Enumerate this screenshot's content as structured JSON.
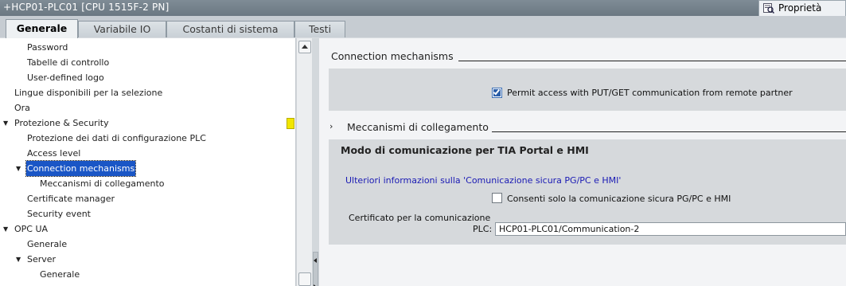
{
  "window": {
    "title": "+HCP01-PLC01 [CPU 1515F-2 PN]",
    "properties_tab": "Proprietà"
  },
  "tabs": [
    "Generale",
    "Variabile IO",
    "Costanti di sistema",
    "Testi"
  ],
  "active_tab": "Generale",
  "tree": [
    {
      "label": "Password",
      "level": 2,
      "caret": ""
    },
    {
      "label": "Tabelle di controllo",
      "level": 2,
      "caret": ""
    },
    {
      "label": "User-defined logo",
      "level": 2,
      "caret": ""
    },
    {
      "label": "Lingue disponibili per la selezione",
      "level": 1,
      "caret": ""
    },
    {
      "label": "Ora",
      "level": 1,
      "caret": ""
    },
    {
      "label": "Protezione & Security",
      "level": 1,
      "caret": "expanded"
    },
    {
      "label": "Protezione dei dati di configurazione PLC",
      "level": 2,
      "caret": ""
    },
    {
      "label": "Access level",
      "level": 2,
      "caret": ""
    },
    {
      "label": "Connection mechanisms",
      "level": 2,
      "caret": "expanded",
      "selected": true
    },
    {
      "label": "Meccanismi di collegamento",
      "level": 3,
      "caret": ""
    },
    {
      "label": "Certificate manager",
      "level": 2,
      "caret": ""
    },
    {
      "label": "Security event",
      "level": 2,
      "caret": ""
    },
    {
      "label": "OPC UA",
      "level": 1,
      "caret": "expanded"
    },
    {
      "label": "Generale",
      "level": 2,
      "caret": ""
    },
    {
      "label": "Server",
      "level": 2,
      "caret": "expanded"
    },
    {
      "label": "Generale",
      "level": 3,
      "caret": ""
    }
  ],
  "content": {
    "section1": {
      "title": "Connection mechanisms",
      "checkbox_label": "Permit access with PUT/GET communication from remote partner",
      "checked": true
    },
    "section2": {
      "title": "Meccanismi di collegamento",
      "subtitle": "Modo di comunicazione per TIA Portal e HMI",
      "link": "Ulteriori informazioni sulla 'Comunicazione sicura PG/PC e HMI'",
      "checkbox_label": "Consenti solo la comunicazione sicura PG/PC e HMI",
      "checked": false,
      "cert_label_line1": "Certificato per la comunicazione",
      "cert_label_line2": "PLC:",
      "cert_value": "HCP01-PLC01/Communication-2"
    }
  },
  "colors": {
    "selection": "#1a56c6",
    "link": "#1a1ab4",
    "marker": "#f2e600"
  }
}
